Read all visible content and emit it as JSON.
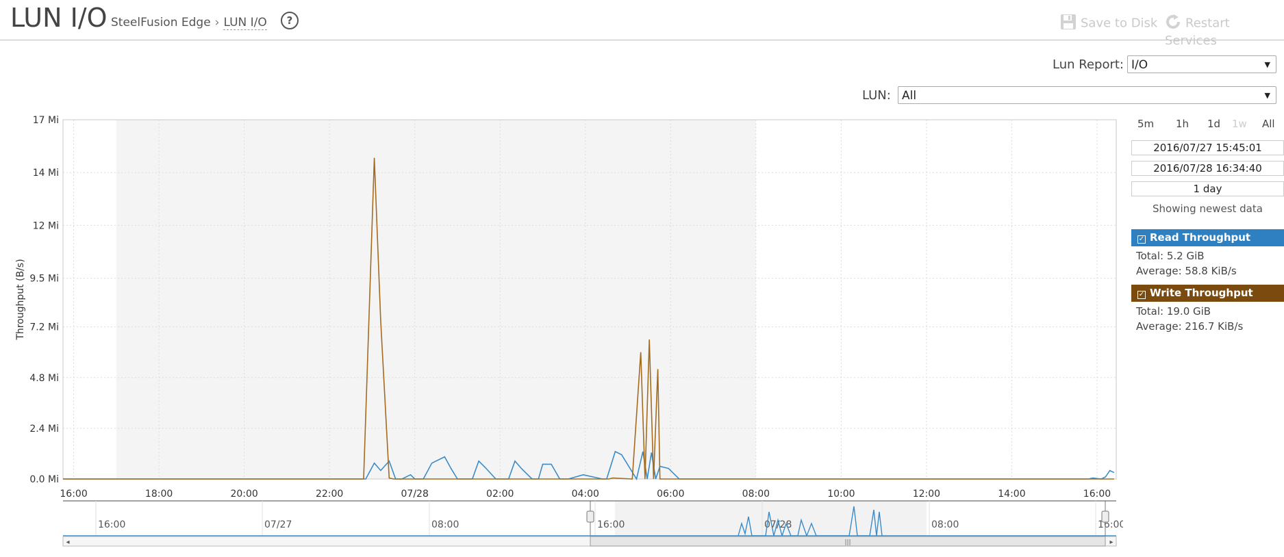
{
  "header": {
    "title": "LUN I/O",
    "breadcrumb": {
      "parent": "SteelFusion Edge",
      "separator": "›",
      "current": "LUN I/O"
    },
    "help_glyph": "?",
    "save_label": "Save to Disk",
    "restart_label": "Restart Services"
  },
  "controls": {
    "lun_report_label": "Lun Report:",
    "lun_report_value": "I/O",
    "lun_label": "LUN:",
    "lun_value": "All"
  },
  "time_controls": {
    "ranges": [
      "5m",
      "1h",
      "1d",
      "1w",
      "All"
    ],
    "disabled_range": "1w",
    "start": "2016/07/27 15:45:01",
    "end": "2016/07/28 16:34:40",
    "duration": "1 day",
    "status": "Showing newest data"
  },
  "legend": {
    "read": {
      "label": "Read Throughput",
      "total": "Total: 5.2 GiB",
      "average": "Average: 58.8 KiB/s",
      "color": "#2e80c0"
    },
    "write": {
      "label": "Write Throughput",
      "total": "Total: 19.0 GiB",
      "average": "Average: 216.7 KiB/s",
      "color": "#7a4a0f"
    }
  },
  "chart_data": {
    "type": "line",
    "ylabel": "Throughput (B/s)",
    "y_ticks": [
      "0.0 Mi",
      "2.4 Mi",
      "4.8 Mi",
      "7.2 Mi",
      "9.5 Mi",
      "12 Mi",
      "14 Mi",
      "17 Mi"
    ],
    "y_tick_values": [
      0,
      2.4,
      4.8,
      7.2,
      9.5,
      12,
      14.5,
      17
    ],
    "ylim": [
      0,
      17
    ],
    "x_unit": "hours since 16:00 (07/27)",
    "x_ticks": [
      "16:00",
      "18:00",
      "20:00",
      "22:00",
      "07/28",
      "02:00",
      "04:00",
      "06:00",
      "08:00",
      "10:00",
      "12:00",
      "14:00",
      "16:00"
    ],
    "x_tick_values": [
      0,
      2,
      4,
      6,
      8,
      10,
      12,
      14,
      16,
      18,
      20,
      22,
      24
    ],
    "xlim": [
      -0.25,
      24.45
    ],
    "grid": true,
    "shaded_range": [
      1,
      16
    ],
    "series": [
      {
        "name": "Read Throughput",
        "color": "#3a8bc8",
        "x": [
          -0.25,
          6.85,
          7.05,
          7.2,
          7.4,
          7.55,
          7.7,
          7.9,
          8.0,
          8.2,
          8.4,
          8.7,
          8.85,
          9.0,
          9.35,
          9.5,
          9.65,
          9.9,
          10.2,
          10.35,
          10.5,
          10.75,
          10.9,
          11.0,
          11.2,
          11.4,
          11.6,
          11.95,
          12.4,
          12.5,
          12.7,
          12.85,
          13.2,
          13.35,
          13.45,
          13.55,
          13.65,
          13.75,
          13.95,
          14.2,
          23.8,
          23.9,
          24.1,
          24.2,
          24.3,
          24.4
        ],
        "y": [
          0,
          0,
          0.75,
          0.4,
          0.85,
          0,
          0,
          0.2,
          0,
          0,
          0.75,
          1.05,
          0.5,
          0,
          0,
          0.85,
          0.55,
          0,
          0,
          0.85,
          0.5,
          0,
          0,
          0.7,
          0.7,
          0,
          0,
          0.2,
          0,
          0,
          1.3,
          1.15,
          0,
          1.3,
          0,
          1.25,
          0,
          0.6,
          0.5,
          0,
          0,
          0.05,
          0,
          0.1,
          0.4,
          0.3
        ]
      },
      {
        "name": "Write Throughput",
        "color": "#a36b1e",
        "x": [
          -0.25,
          6.8,
          7.05,
          7.2,
          7.4,
          7.5,
          12.55,
          12.65,
          13.1,
          13.3,
          13.4,
          13.5,
          13.6,
          13.7,
          13.75,
          24.4
        ],
        "y": [
          0,
          0,
          15.2,
          7.5,
          0.05,
          0,
          0,
          0.05,
          0,
          6.0,
          0,
          6.6,
          0,
          5.2,
          0,
          0
        ]
      }
    ]
  },
  "navigator": {
    "tick_labels": [
      "16:00",
      "07/27",
      "08:00",
      "16:00",
      "07/28",
      "08:00",
      "16:00"
    ],
    "scroll_glyphs": {
      "left": "◂",
      "right": "▸",
      "grip": "|||"
    }
  }
}
